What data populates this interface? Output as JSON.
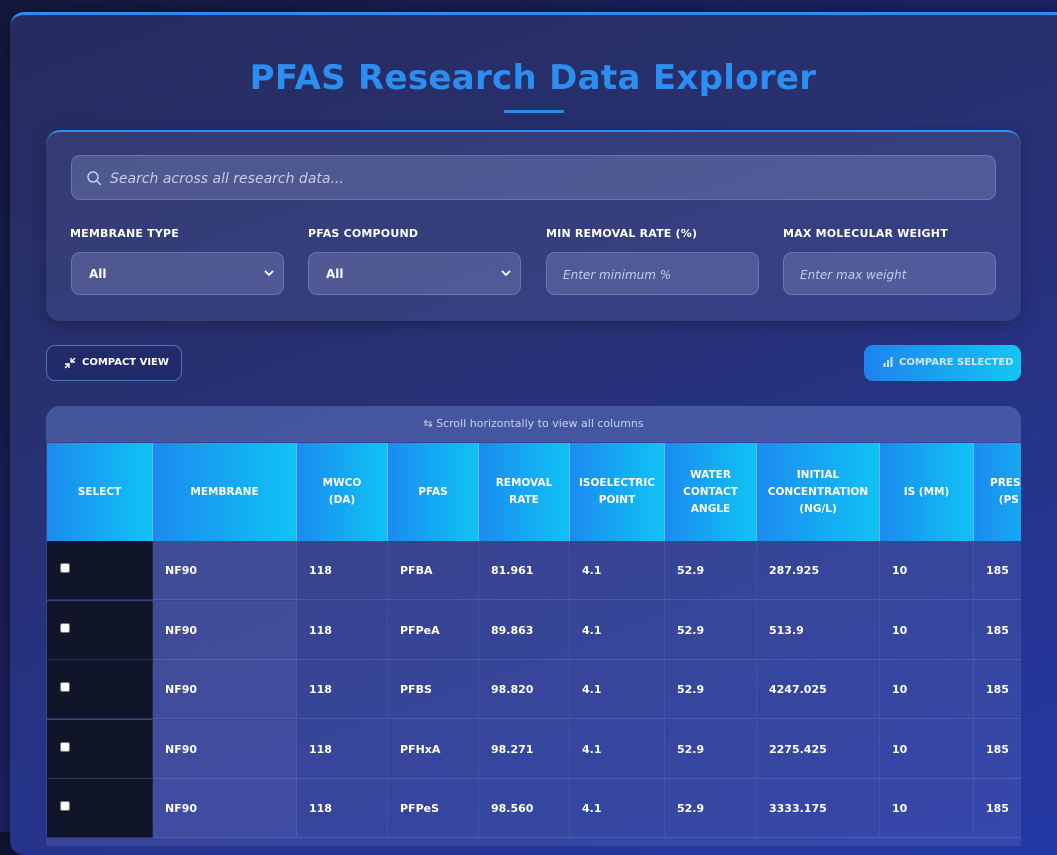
{
  "title": "PFAS Research Data Explorer",
  "search": {
    "placeholder": "Search across all research data..."
  },
  "filters": {
    "membrane_type": {
      "label": "MEMBRANE TYPE",
      "value": "All"
    },
    "pfas_compound": {
      "label": "PFAS COMPOUND",
      "value": "All"
    },
    "min_removal": {
      "label": "MIN REMOVAL RATE (%)",
      "placeholder": "Enter minimum %"
    },
    "max_mw": {
      "label": "MAX MOLECULAR WEIGHT",
      "placeholder": "Enter max weight"
    }
  },
  "actions": {
    "compact_label": "COMPACT VIEW",
    "compare_label": "COMPARE SELECTED"
  },
  "table": {
    "hint": "⇆ Scroll horizontally to view all columns",
    "columns": [
      "SELECT",
      "MEMBRANE",
      "MWCO\n(DA)",
      "PFAS",
      "REMOVAL\nRATE",
      "ISOELECTRIC\nPOINT",
      "WATER\nCONTACT\nANGLE",
      "INITIAL\nCONCENTRATION\n(NG/L)",
      "IS (MM)",
      "PRESS\n(PS"
    ],
    "rows": [
      [
        "NF90",
        "118",
        "PFBA",
        "81.961",
        "4.1",
        "52.9",
        "287.925",
        "10",
        "185"
      ],
      [
        "NF90",
        "118",
        "PFPeA",
        "89.863",
        "4.1",
        "52.9",
        "513.9",
        "10",
        "185"
      ],
      [
        "NF90",
        "118",
        "PFBS",
        "98.820",
        "4.1",
        "52.9",
        "4247.025",
        "10",
        "185"
      ],
      [
        "NF90",
        "118",
        "PFHxA",
        "98.271",
        "4.1",
        "52.9",
        "2275.425",
        "10",
        "185"
      ],
      [
        "NF90",
        "118",
        "PFPeS",
        "98.560",
        "4.1",
        "52.9",
        "3333.175",
        "10",
        "185"
      ]
    ]
  },
  "colors": {
    "accent": "#2d8ef2",
    "header_start": "#1b8bf0",
    "header_end": "#10c3f4"
  }
}
